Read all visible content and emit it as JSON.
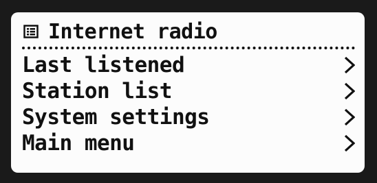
{
  "screen": {
    "header": {
      "icon": "menu-list-icon",
      "title": "Internet radio"
    },
    "menu": {
      "items": [
        {
          "label": "Last listened",
          "icon": "chevron-right-icon"
        },
        {
          "label": "Station list",
          "icon": "chevron-right-icon"
        },
        {
          "label": "System settings",
          "icon": "chevron-right-icon"
        },
        {
          "label": "Main menu",
          "icon": "chevron-right-icon"
        }
      ]
    },
    "colors": {
      "background": "#fcfcfc",
      "text": "#111111",
      "bezel": "#1a1a1a"
    }
  }
}
